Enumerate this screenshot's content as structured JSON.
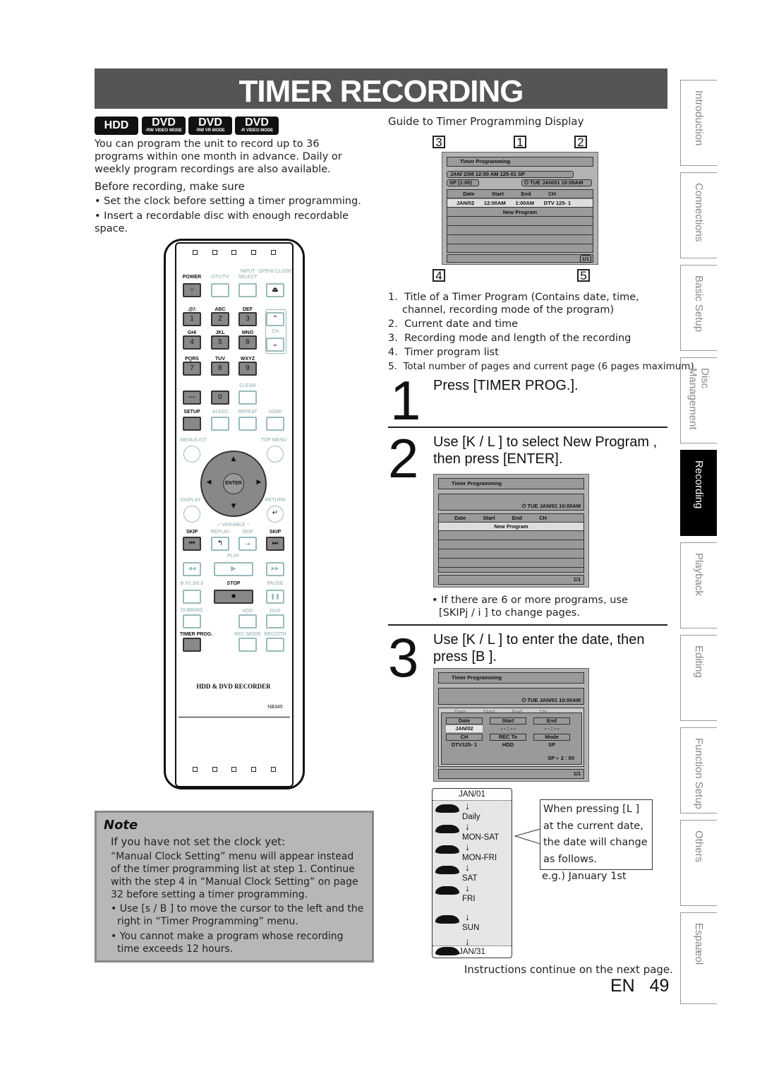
{
  "banner": {
    "title": "TIMER RECORDING"
  },
  "logos": [
    {
      "main": "HDD",
      "sub": ""
    },
    {
      "main": "DVD",
      "sub": "-RW VIDEO MODE"
    },
    {
      "main": "DVD",
      "sub": "-RW VR MODE"
    },
    {
      "main": "DVD",
      "sub": "-R VIDEO MODE"
    }
  ],
  "intro": {
    "text": "You can program the unit to record up to 36 programs within one month in advance. Daily or weekly program recordings are also available.",
    "before_heading": "Before recording, make sure",
    "bullets": [
      "Set the clock before setting a timer programming.",
      "Insert a recordable disc with enough recordable space."
    ]
  },
  "guide": {
    "heading": "Guide to Timer Programming Display",
    "callouts": [
      "3",
      "1",
      "2",
      "4",
      "5"
    ],
    "screen": {
      "title": "Timer Programming",
      "line1": "JAN/  2/08  12:00 AM 125-01 SP",
      "mode": "SP  (1:00)",
      "clock": "TUE JAN/01 10:00AM",
      "headers": [
        "Date",
        "Start",
        "End",
        "CH"
      ],
      "program": [
        "JAN/02",
        "12:00AM",
        "1:00AM",
        "DTV 125- 1"
      ],
      "new_program": "New Program",
      "page": "1/1"
    },
    "items": [
      "Title of a Timer Program (Contains date, time, channel, recording mode of the program)",
      "Current date and time",
      "Recording mode and length of the recording",
      "Timer program list",
      "Total number of pages and current page (6 pages maximum)"
    ]
  },
  "steps": [
    {
      "num": "1",
      "text": "Press [TIMER PROG.]."
    },
    {
      "num": "2",
      "text": "Use [K / L ] to select  New Program ,",
      "text2": "then press [ENTER].",
      "screen": {
        "title": "Timer Programming",
        "clock": "TUE JAN/01 10:00AM",
        "headers": [
          "Date",
          "Start",
          "End",
          "CH"
        ],
        "new_program": "New Program",
        "page": "1/1"
      },
      "note": "If there are 6 or more programs, use",
      "note2": "[SKIPj       / i      ] to change pages."
    },
    {
      "num": "3",
      "text": "Use [K / L ] to enter the date, then",
      "text2": "press [B ].",
      "screen": {
        "title": "Timer Programming",
        "clock": "TUE JAN/01 10:00AM",
        "faded_headers": [
          "Date",
          "Start",
          "End",
          "CH"
        ],
        "fields": [
          {
            "label": "Date",
            "value": "JAN/02"
          },
          {
            "label": "Start",
            "value": "- - : - -"
          },
          {
            "label": "End",
            "value": "- - : - -"
          },
          {
            "label": "CH",
            "value": "DTV125- 1"
          },
          {
            "label": "REC To",
            "value": "HDD"
          },
          {
            "label": "Mode",
            "value": "SP"
          }
        ],
        "remaining": "SP",
        "remaining_time": "2 : 00",
        "page": "1/1"
      }
    }
  ],
  "date_cycle": {
    "top": "JAN/01",
    "items": [
      "Daily",
      "MON-SAT",
      "MON-FRI",
      "SAT",
      "FRI",
      "SUN"
    ],
    "bottom": "JAN/31",
    "callout": "When pressing [L ] at the current date, the date will change as follows.",
    "example": "e.g.) January 1st"
  },
  "continue": "Instructions continue on the next page.",
  "page": {
    "lang": "EN",
    "number": "49"
  },
  "note": {
    "heading": "Note",
    "subheading": "If you have not set the clock yet:",
    "body": "“Manual Clock Setting” menu will appear instead of the timer programming list at step 1. Continue with the step 4 in “Manual Clock Setting” on page 32 before setting a timer programming.",
    "bullets": [
      "Use [s   / B ] to move the cursor to the left and the right in “Timer Programming” menu.",
      "You cannot make a program whose recording time exceeds 12 hours."
    ]
  },
  "side_tabs": [
    {
      "label": "Introduction"
    },
    {
      "label": "Connections"
    },
    {
      "label": "Basic Setup"
    },
    {
      "label": "Disc Management"
    },
    {
      "label": "Recording",
      "active": true
    },
    {
      "label": "Playback"
    },
    {
      "label": "Editing"
    },
    {
      "label": "Function Setup"
    },
    {
      "label": "Others"
    },
    {
      "label": "Espaæol"
    }
  ],
  "remote": {
    "model": "HDD & DVD RECORDER",
    "code": "NB345",
    "labels": {
      "power": "POWER",
      "dtvtv": "DTV/TV",
      "input": "INPUT SELECT",
      "open": "OPEN/ CLOSE",
      "sym": ".@/:",
      "abc": "ABC",
      "def": "DEF",
      "ghi": "GHI",
      "jkl": "JKL",
      "mno": "MNO",
      "pqrs": "PQRS",
      "tuv": "TUV",
      "wxyz": "WXYZ",
      "clear": "CLEAR",
      "setup": "SETUP",
      "audio": "AUDIO",
      "repeat": "REPEAT",
      "hdmi": "HDMI",
      "menu": "MENU/LIST",
      "top": "TOP MENU",
      "display": "DISPLAY",
      "return": "RETURN",
      "variable": "VARIABLE",
      "skip_l": "SKIP",
      "replay": "REPLAY",
      "vskip": "SKIP",
      "skip_r": "SKIP",
      "play": "PLAY",
      "speed": "B X1.3/0.8",
      "stop": "STOP",
      "pause": "PAUSE",
      "dubbing": "DUBBING",
      "hdd": "HDD",
      "dvd": "DVD",
      "timer": "TIMER PROG.",
      "recmode": "REC MODE",
      "recotr": "REC/OTR",
      "ch": "CH",
      "enter": "ENTER"
    },
    "keys": {
      "n1": "1",
      "n2": "2",
      "n3": "3",
      "n4": "4",
      "n5": "5",
      "n6": "6",
      "n7": "7",
      "n8": "8",
      "n9": "9",
      "n0": "0",
      "dash": "—"
    }
  },
  "colors": {
    "banner": "#555555",
    "active_tab": "#000000",
    "note_bg": "#b7b7b7",
    "screen_bg": "#b3b3b3"
  }
}
